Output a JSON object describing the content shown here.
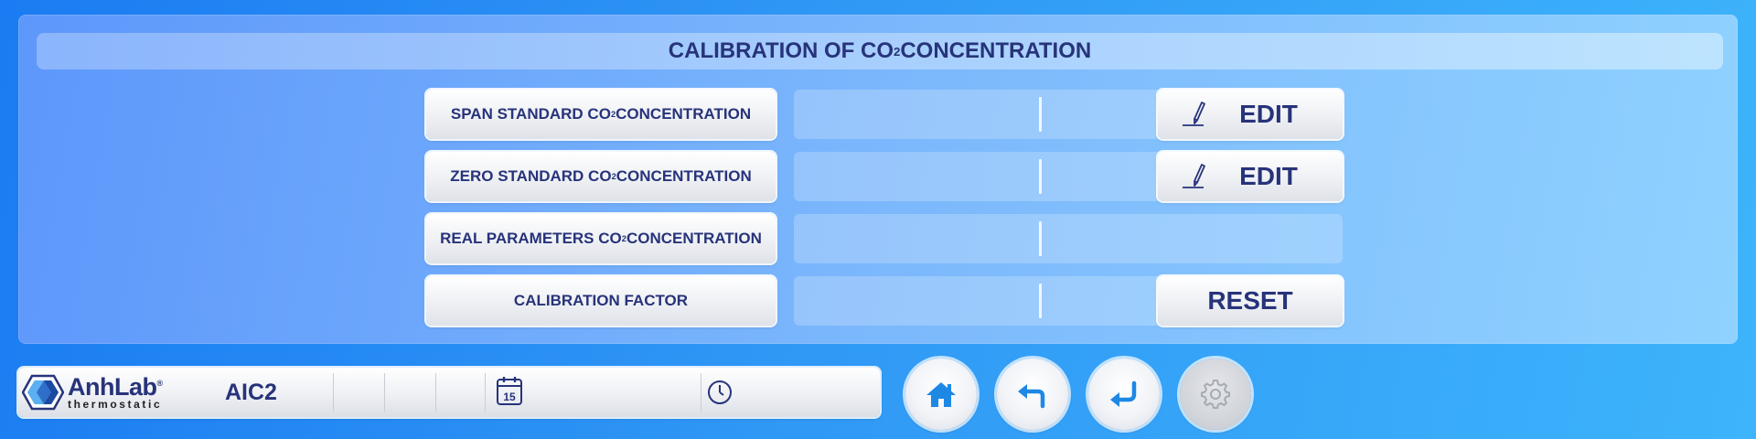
{
  "title": {
    "text": "CALIBRATION OF CO",
    "sub": "2",
    "suffix": " CONCENTRATION"
  },
  "rows": [
    {
      "label_pre": "SPAN STANDARD CO",
      "label_sub": "2",
      "label_post": " CONCENTRATION",
      "value": "",
      "unit": "",
      "action": "EDIT"
    },
    {
      "label_pre": "ZERO STANDARD CO",
      "label_sub": "2",
      "label_post": " CONCENTRATION",
      "value": "",
      "unit": "",
      "action": "EDIT"
    },
    {
      "label_pre": "REAL PARAMETERS CO",
      "label_sub": "2",
      "label_post": " CONCENTRATION",
      "value": "",
      "unit": ""
    },
    {
      "label_pre": "CALIBRATION FACTOR",
      "label_sub": "",
      "label_post": "",
      "value": "",
      "unit": "",
      "action": "RESET"
    }
  ],
  "status_bar": {
    "brand": "AnhLab",
    "brand_mark": "®",
    "brand_sub": "thermostatic",
    "model": "AIC2",
    "calendar_day": "15",
    "date": "",
    "time": ""
  },
  "nav": {
    "home_icon": "home-icon",
    "back_icon": "back-arrow-icon",
    "enter_icon": "enter-arrow-icon",
    "settings_icon": "gear-icon"
  },
  "colors": {
    "text": "#27337a",
    "accent": "#1e88e5",
    "background": "#2f97f5"
  }
}
